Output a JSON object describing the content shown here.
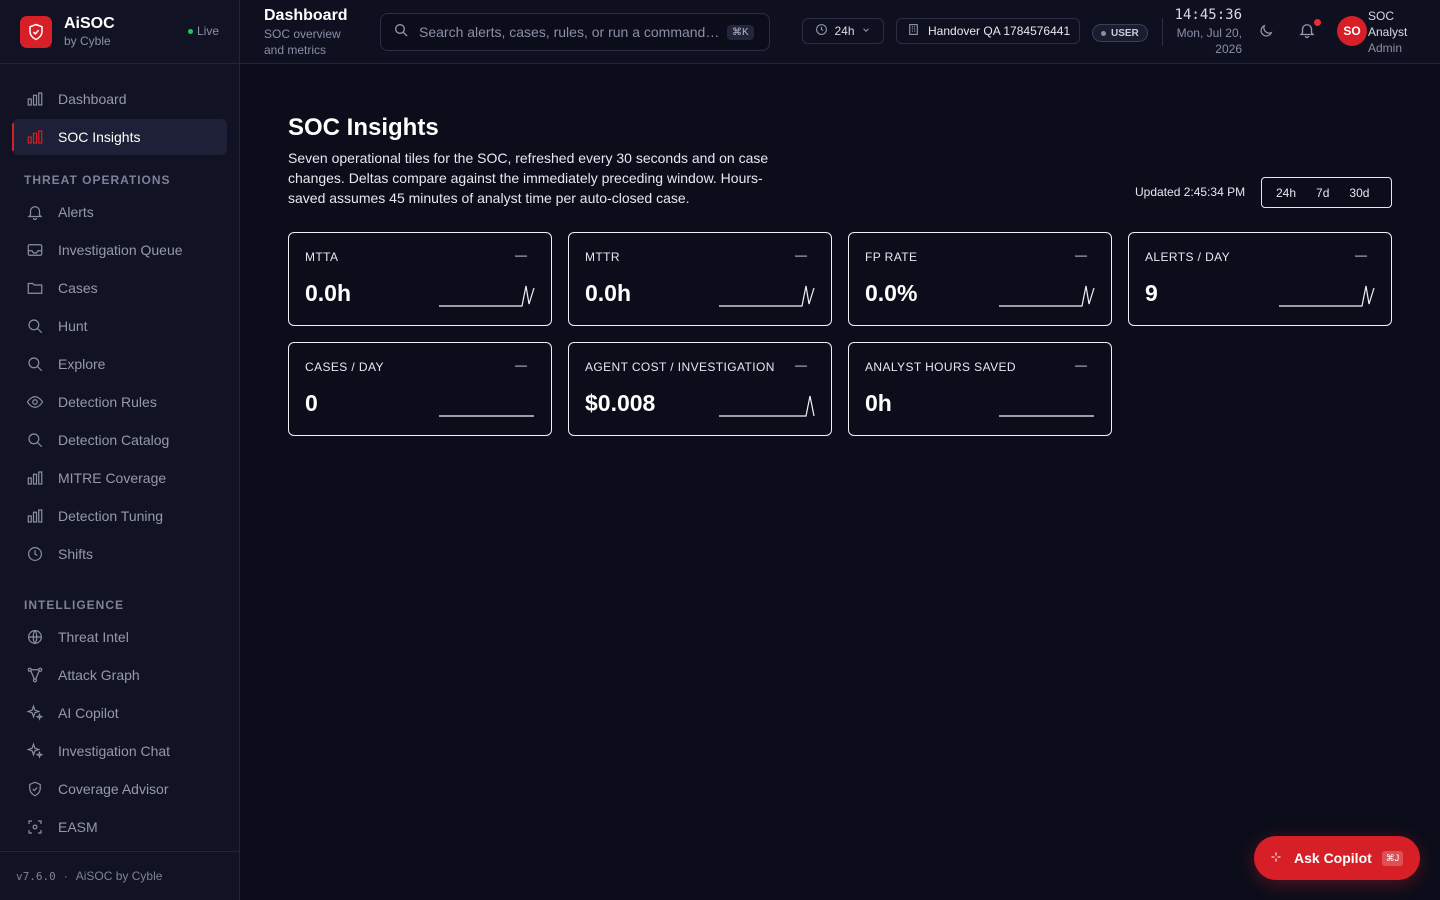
{
  "brand": {
    "name": "AiSOC",
    "sub": "by Cyble",
    "live": "Live"
  },
  "nav": {
    "top": [
      {
        "label": "Dashboard",
        "icon": "bar-chart-icon"
      },
      {
        "label": "SOC Insights",
        "icon": "bar-chart-icon",
        "active": true
      }
    ],
    "section1": "THREAT OPERATIONS",
    "threat": [
      {
        "label": "Alerts",
        "icon": "bell-icon"
      },
      {
        "label": "Investigation Queue",
        "icon": "inbox-icon"
      },
      {
        "label": "Cases",
        "icon": "folder-icon"
      },
      {
        "label": "Hunt",
        "icon": "search-icon"
      },
      {
        "label": "Explore",
        "icon": "search-icon"
      },
      {
        "label": "Detection Rules",
        "icon": "eye-icon"
      },
      {
        "label": "Detection Catalog",
        "icon": "search-icon"
      },
      {
        "label": "MITRE Coverage",
        "icon": "bar-chart-icon"
      },
      {
        "label": "Detection Tuning",
        "icon": "bar-chart-icon"
      },
      {
        "label": "Shifts",
        "icon": "clock-icon"
      }
    ],
    "section2": "INTELLIGENCE",
    "intel": [
      {
        "label": "Threat Intel",
        "icon": "globe-icon"
      },
      {
        "label": "Attack Graph",
        "icon": "graph-icon"
      },
      {
        "label": "AI Copilot",
        "icon": "sparkle-icon"
      },
      {
        "label": "Investigation Chat",
        "icon": "sparkle-icon"
      },
      {
        "label": "Coverage Advisor",
        "icon": "shield-icon"
      },
      {
        "label": "EASM",
        "icon": "scan-icon"
      }
    ]
  },
  "footer": {
    "version": "v7.6.0",
    "sep": "·",
    "name": "AiSOC by Cyble"
  },
  "header": {
    "title": "Dashboard",
    "subtitle": "SOC overview and metrics",
    "search_placeholder": "Search alerts, cases, rules, or run a command…",
    "search_kbd": "⌘K",
    "timerange": "24h",
    "handover": "Handover QA 1784576441",
    "role": "USER",
    "time": "14:45:36",
    "date": "Mon, Jul 20, 2026",
    "avatar": "SO",
    "user_name": "SOC Analyst",
    "user_role": "Admin"
  },
  "page": {
    "title": "SOC Insights",
    "description": "Seven operational tiles for the SOC, refreshed every 30 seconds and on case changes. Deltas compare against the immediately preceding window. Hours-saved assumes 45 minutes of analyst time per auto-closed case.",
    "updated": "Updated 2:45:34 PM",
    "ranges": [
      "24h",
      "7d",
      "30d"
    ]
  },
  "tiles": [
    {
      "label": "MTTA",
      "value": "0.0h",
      "delta": "—",
      "spark": "spike2"
    },
    {
      "label": "MTTR",
      "value": "0.0h",
      "delta": "—",
      "spark": "spike2"
    },
    {
      "label": "FP RATE",
      "value": "0.0%",
      "delta": "—",
      "spark": "spike2"
    },
    {
      "label": "ALERTS / DAY",
      "value": "9",
      "delta": "—",
      "spark": "spike2"
    },
    {
      "label": "CASES / DAY",
      "value": "0",
      "delta": "—",
      "spark": "flat"
    },
    {
      "label": "AGENT COST / INVESTIGATION",
      "value": "$0.008",
      "delta": "—",
      "spark": "spike1"
    },
    {
      "label": "ANALYST HOURS SAVED",
      "value": "0h",
      "delta": "—",
      "spark": "flat"
    }
  ],
  "copilot": {
    "label": "Ask Copilot",
    "kbd": "⌘J"
  },
  "colors": {
    "accent": "#d61f26",
    "bg": "#0b0d1a",
    "sidebar": "#111324",
    "live": "#22c55e"
  }
}
